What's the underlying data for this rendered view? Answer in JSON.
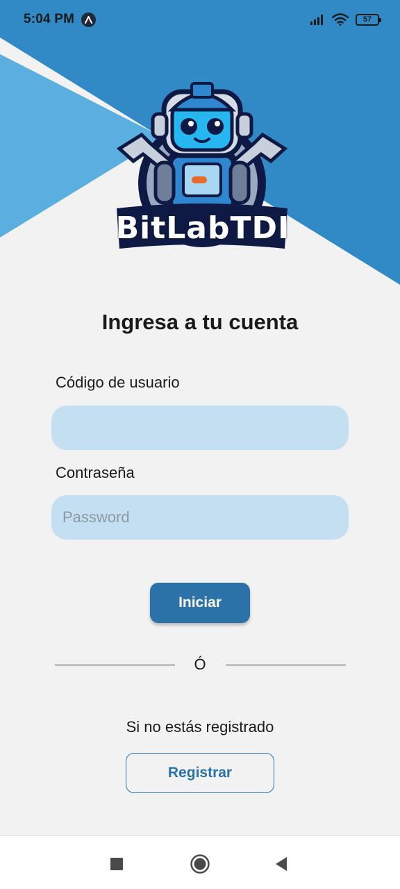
{
  "status_bar": {
    "time": "5:04 PM",
    "battery": "57",
    "icons": [
      "app-notification-icon",
      "signal-icon",
      "wifi-icon",
      "battery-icon"
    ]
  },
  "logo": {
    "text": "BitLabTDI",
    "icon": "robot-mascot-logo"
  },
  "login": {
    "title": "Ingresa a tu cuenta",
    "user_label": "Código de usuario",
    "user_value": "",
    "user_placeholder": "",
    "password_label": "Contraseña",
    "password_value": "",
    "password_placeholder": "Password",
    "submit_label": "Iniciar"
  },
  "divider": {
    "text": "Ó"
  },
  "register": {
    "hint": "Si no estás registrado",
    "button_label": "Registrar"
  },
  "nav_bar": {
    "icons": [
      "recents-icon",
      "home-icon",
      "back-icon"
    ]
  },
  "colors": {
    "background": "#f2f2f2",
    "header_dark_blue": "#3189c6",
    "header_light_blue": "#5aaee0",
    "input_background": "#c4dff2",
    "primary_button": "#2a72a8",
    "outline_button": "#2a72a8"
  }
}
